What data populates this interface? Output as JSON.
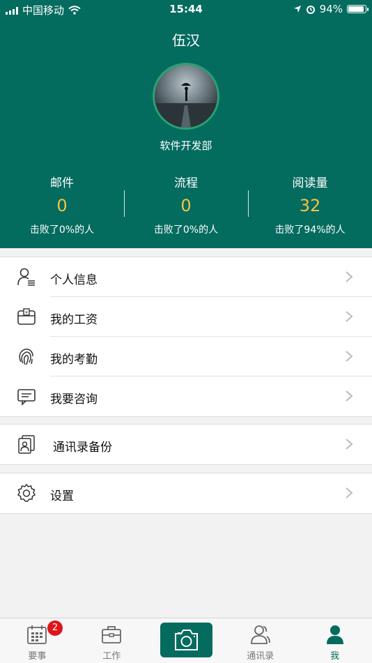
{
  "status_bar": {
    "carrier": "中国移动",
    "time": "15:44",
    "battery": "94%"
  },
  "profile": {
    "name": "伍汉",
    "department": "软件开发部"
  },
  "stats": [
    {
      "title": "邮件",
      "value": "0",
      "subtitle": "击败了0%的人"
    },
    {
      "title": "流程",
      "value": "0",
      "subtitle": "击败了0%的人"
    },
    {
      "title": "阅读量",
      "value": "32",
      "subtitle": "击败了94%的人"
    }
  ],
  "menu": {
    "group1": [
      {
        "label": "个人信息",
        "icon": "person-list-icon"
      },
      {
        "label": "我的工资",
        "icon": "wallet-icon"
      },
      {
        "label": "我的考勤",
        "icon": "fingerprint-icon"
      },
      {
        "label": "我要咨询",
        "icon": "message-icon"
      }
    ],
    "group2": [
      {
        "label": "通讯录备份",
        "icon": "contacts-backup-icon"
      }
    ],
    "group3": [
      {
        "label": "设置",
        "icon": "gear-icon"
      }
    ]
  },
  "tabs": [
    {
      "label": "要事",
      "badge": "2"
    },
    {
      "label": "工作"
    },
    {
      "label": ""
    },
    {
      "label": "通讯录"
    },
    {
      "label": "我"
    }
  ],
  "colors": {
    "primary": "#046b5f",
    "accent": "#f5c342",
    "badge": "#e0151b"
  }
}
